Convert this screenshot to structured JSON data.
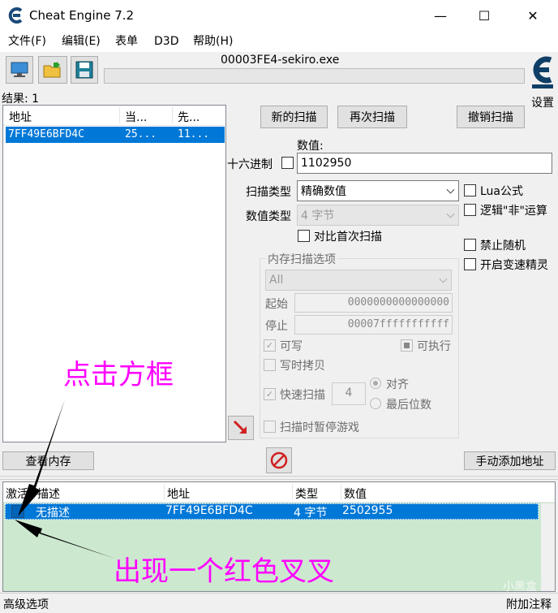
{
  "window": {
    "title": "Cheat Engine 7.2",
    "process_name": "00003FE4-sekiro.exe",
    "minimize": "—",
    "maximize": "☐",
    "close": "✕"
  },
  "menu": [
    "文件(F)",
    "编辑(E)",
    "表单",
    "D3D",
    "帮助(H)"
  ],
  "settings_label": "设置",
  "results": {
    "label": "结果: 1",
    "columns": [
      "地址",
      "当...",
      "先..."
    ],
    "rows": [
      [
        "7FF49E6BFD4C",
        "25...",
        "11..."
      ]
    ]
  },
  "scan_buttons": {
    "new_scan": "新的扫描",
    "next_scan": "再次扫描",
    "undo_scan": "撤销扫描"
  },
  "value": {
    "label": "数值:",
    "hex_label": "十六进制",
    "input": "1102950"
  },
  "scan_type": {
    "label": "扫描类型",
    "selected": "精确数值"
  },
  "value_type": {
    "label": "数值类型",
    "selected": "4 字节"
  },
  "compare_first": "对比首次扫描",
  "right_options": {
    "lua": "Lua公式",
    "not_op": "逻辑\"非\"运算",
    "no_random": "禁止随机",
    "speedhack": "开启变速精灵"
  },
  "memory_scan": {
    "title": "内存扫描选项",
    "region": "All",
    "start_label": "起始",
    "start_value": "0000000000000000",
    "stop_label": "停止",
    "stop_value": "00007fffffffffff",
    "writable": "可写",
    "executable": "可执行",
    "copy_on_write": "写时拷贝",
    "fast_scan": "快速扫描",
    "fast_scan_value": "4",
    "align": "对齐",
    "last_digits": "最后位数",
    "pause_game": "扫描时暂停游戏"
  },
  "view_memory": "查看内存",
  "add_address": "手动添加地址",
  "address_table": {
    "columns": [
      "激活",
      "描述",
      "地址",
      "类型",
      "数值"
    ],
    "rows": [
      [
        "",
        "无描述",
        "7FF49E6BFD4C",
        "4 字节",
        "2502955"
      ]
    ]
  },
  "statusbar": {
    "left": "高级选项",
    "right": "附加注释"
  },
  "annotations": {
    "top": "点击方框",
    "bottom": "出现一个红色叉叉",
    "color": "#ff00ff"
  },
  "watermark": "小黑盒",
  "colors": {
    "selection": "#0078d7",
    "table_bg": "#cce8cf",
    "annotation": "#ff00ff"
  }
}
